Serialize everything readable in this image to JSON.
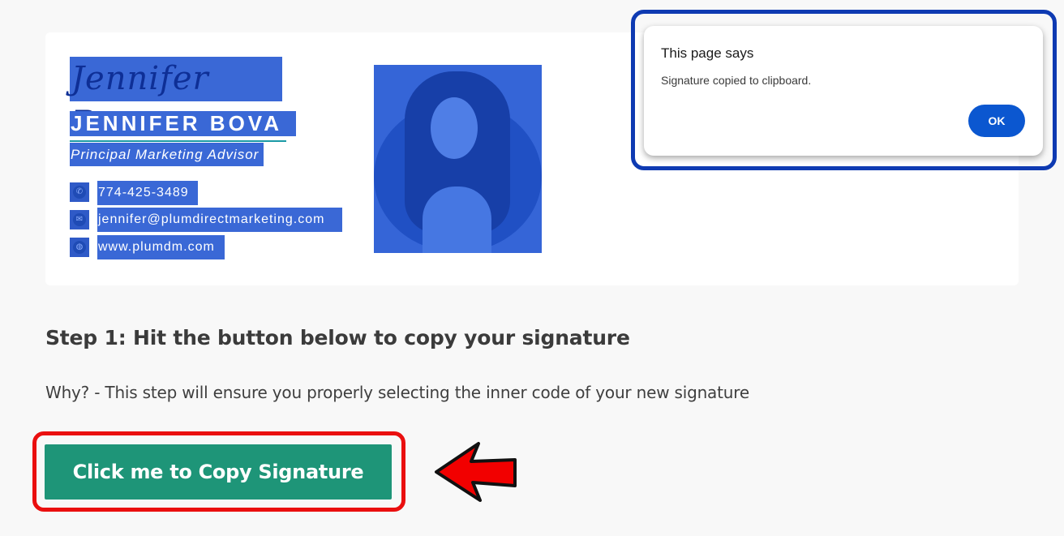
{
  "signature": {
    "script_name": "Jennifer Bova",
    "full_name": "JENNIFER BOVA",
    "title": "Principal Marketing Advisor",
    "phone": "774-425-3489",
    "email": "jennifer@plumdirectmarketing.com",
    "website": "www.plumdm.com",
    "icons": [
      "phone-icon",
      "email-icon",
      "globe-icon"
    ]
  },
  "instructions": {
    "step_heading": "Step 1: Hit the button below to copy your signature",
    "step_note": "Why? - This step will ensure you properly selecting the inner code of your new signature",
    "copy_button_label": "Click me to Copy Signature"
  },
  "dialog": {
    "title": "This page says",
    "message": "Signature copied to clipboard.",
    "ok_label": "OK"
  },
  "colors": {
    "selection": "#3a68d6",
    "button": "#1e9578",
    "highlight_red": "#ea0f0f",
    "highlight_blue": "#0e3ab2",
    "ok_button": "#0b57d0"
  }
}
